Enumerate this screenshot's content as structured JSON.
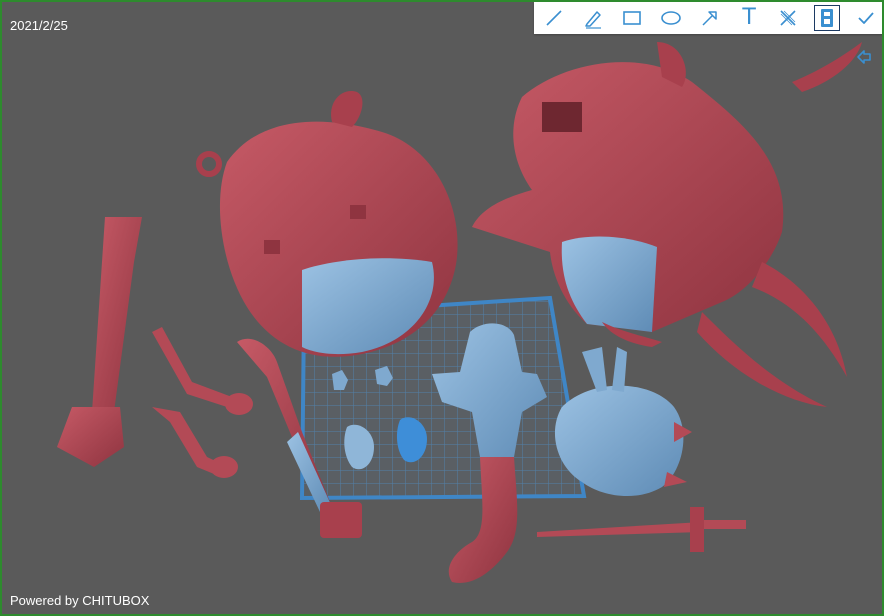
{
  "overlay": {
    "date": "2021/2/25",
    "powered_by": "Powered by CHITUBOX"
  },
  "toolbar": {
    "tools": [
      {
        "name": "line-tool",
        "icon": "line-icon"
      },
      {
        "name": "pen-tool",
        "icon": "pen-icon"
      },
      {
        "name": "rectangle-tool",
        "icon": "rectangle-icon"
      },
      {
        "name": "ellipse-tool",
        "icon": "ellipse-icon"
      },
      {
        "name": "arrow-tool",
        "icon": "arrow-icon"
      },
      {
        "name": "text-tool",
        "icon": "text-icon",
        "glyph": "T"
      },
      {
        "name": "mosaic-tool",
        "icon": "mosaic-icon"
      },
      {
        "name": "save-tool",
        "icon": "save-icon",
        "selected": true
      },
      {
        "name": "confirm-tool",
        "icon": "checkmark-icon"
      }
    ],
    "accent": "#3a8fd0"
  },
  "side_button": {
    "icon": "collapse-left-arrow-icon"
  },
  "colors": {
    "background": "#5a5a5a",
    "frame_border": "#2e8b2e",
    "model_red": "#b34a56",
    "model_blue": "#7fa9cf",
    "platform_grid": "#4f8fc8"
  }
}
